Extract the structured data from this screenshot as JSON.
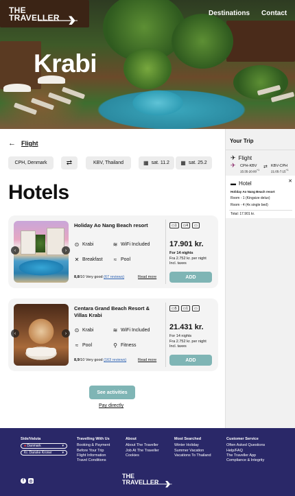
{
  "header": {
    "logo_line1": "THE",
    "logo_line2": "TRAVELLER",
    "nav": [
      "Destinations",
      "Contact"
    ],
    "hero_title": "Krabi"
  },
  "search": {
    "back_label": "Flight",
    "from": "CPH, Denmark",
    "to": "KBV, Thailand",
    "date_out": "sat. 11.2",
    "date_back": "sat. 25.2"
  },
  "page_title": "Hotels",
  "hotels": [
    {
      "name": "Holiday Ao Nang Beach resort",
      "features": [
        "Krabi",
        "WiFi Included",
        "Breakfast",
        "Pool"
      ],
      "rating_score": "8,8",
      "rating_text": "/10 Very good",
      "reviews": "(67 reviews)",
      "read_more": "Read more",
      "rooms": [
        "1",
        "4",
        ""
      ],
      "price": "17.901 kr.",
      "nights": "For 14 nights",
      "per_night": "Fra 2.752 kr. per night",
      "taxes": "Incl. taxes",
      "add": "ADD"
    },
    {
      "name": "Centara Grand Beach Resort & Villas Krabi",
      "features": [
        "Krabi",
        "WiFi Included",
        "Pool",
        "Fitness"
      ],
      "rating_score": "8,9",
      "rating_text": "/10 Very good",
      "reviews": "(163 reviews)",
      "read_more": "Read more",
      "rooms": [
        "5",
        "1",
        ""
      ],
      "price": "21.431 kr.",
      "nights": "For 14 nights",
      "per_night": "Fra 2.752 kr. per night",
      "taxes": "Incl. taxes",
      "add": "ADD"
    }
  ],
  "actions": {
    "see_activities": "See activities",
    "pay_directly": "Pay directly"
  },
  "trip": {
    "title": "Your Trip",
    "flight_label": "Flight",
    "out_route": "CPH-KBV",
    "out_time": "15:35-20:00",
    "out_sup": "+1",
    "back_route": "KBV-CPH",
    "back_time": "21:05-7:15",
    "back_sup": "+1",
    "hotel_label": "Hotel",
    "hotel_name": "Holiday Ao Nang Beach resort",
    "room1": "Room - 1 (Kingsize delux)",
    "room2": "Room - 4 (4x single bed)",
    "total": "Total: 17.901 kr."
  },
  "footer": {
    "side_title": "Side/Valuta",
    "country": "Danmark",
    "currency": "Kr. Danske Kroner",
    "col1_title": "Travelling With Us",
    "col1": [
      "Booking & Payment",
      "Before Your Trip",
      "Flight Information",
      "Travel Conditions"
    ],
    "col2_title": "About",
    "col2": [
      "About The Traveller",
      "Job At The Traveller",
      "Cookies"
    ],
    "col3_title": "Most Searched",
    "col3": [
      "Winter Holiday",
      "Summer Vacation",
      "Vacations To Thailand"
    ],
    "col4_title": "Customer Service",
    "col4": [
      "Often Asked Questions",
      "Help/FAQ",
      "The Traveller App",
      "Compliance & Integrity"
    ],
    "logo_line1": "THE",
    "logo_line2": "TRAVELLER"
  },
  "colors": {
    "accent": "#7fb5b5",
    "footer": "#2a2868",
    "link": "#2a5fb0"
  }
}
